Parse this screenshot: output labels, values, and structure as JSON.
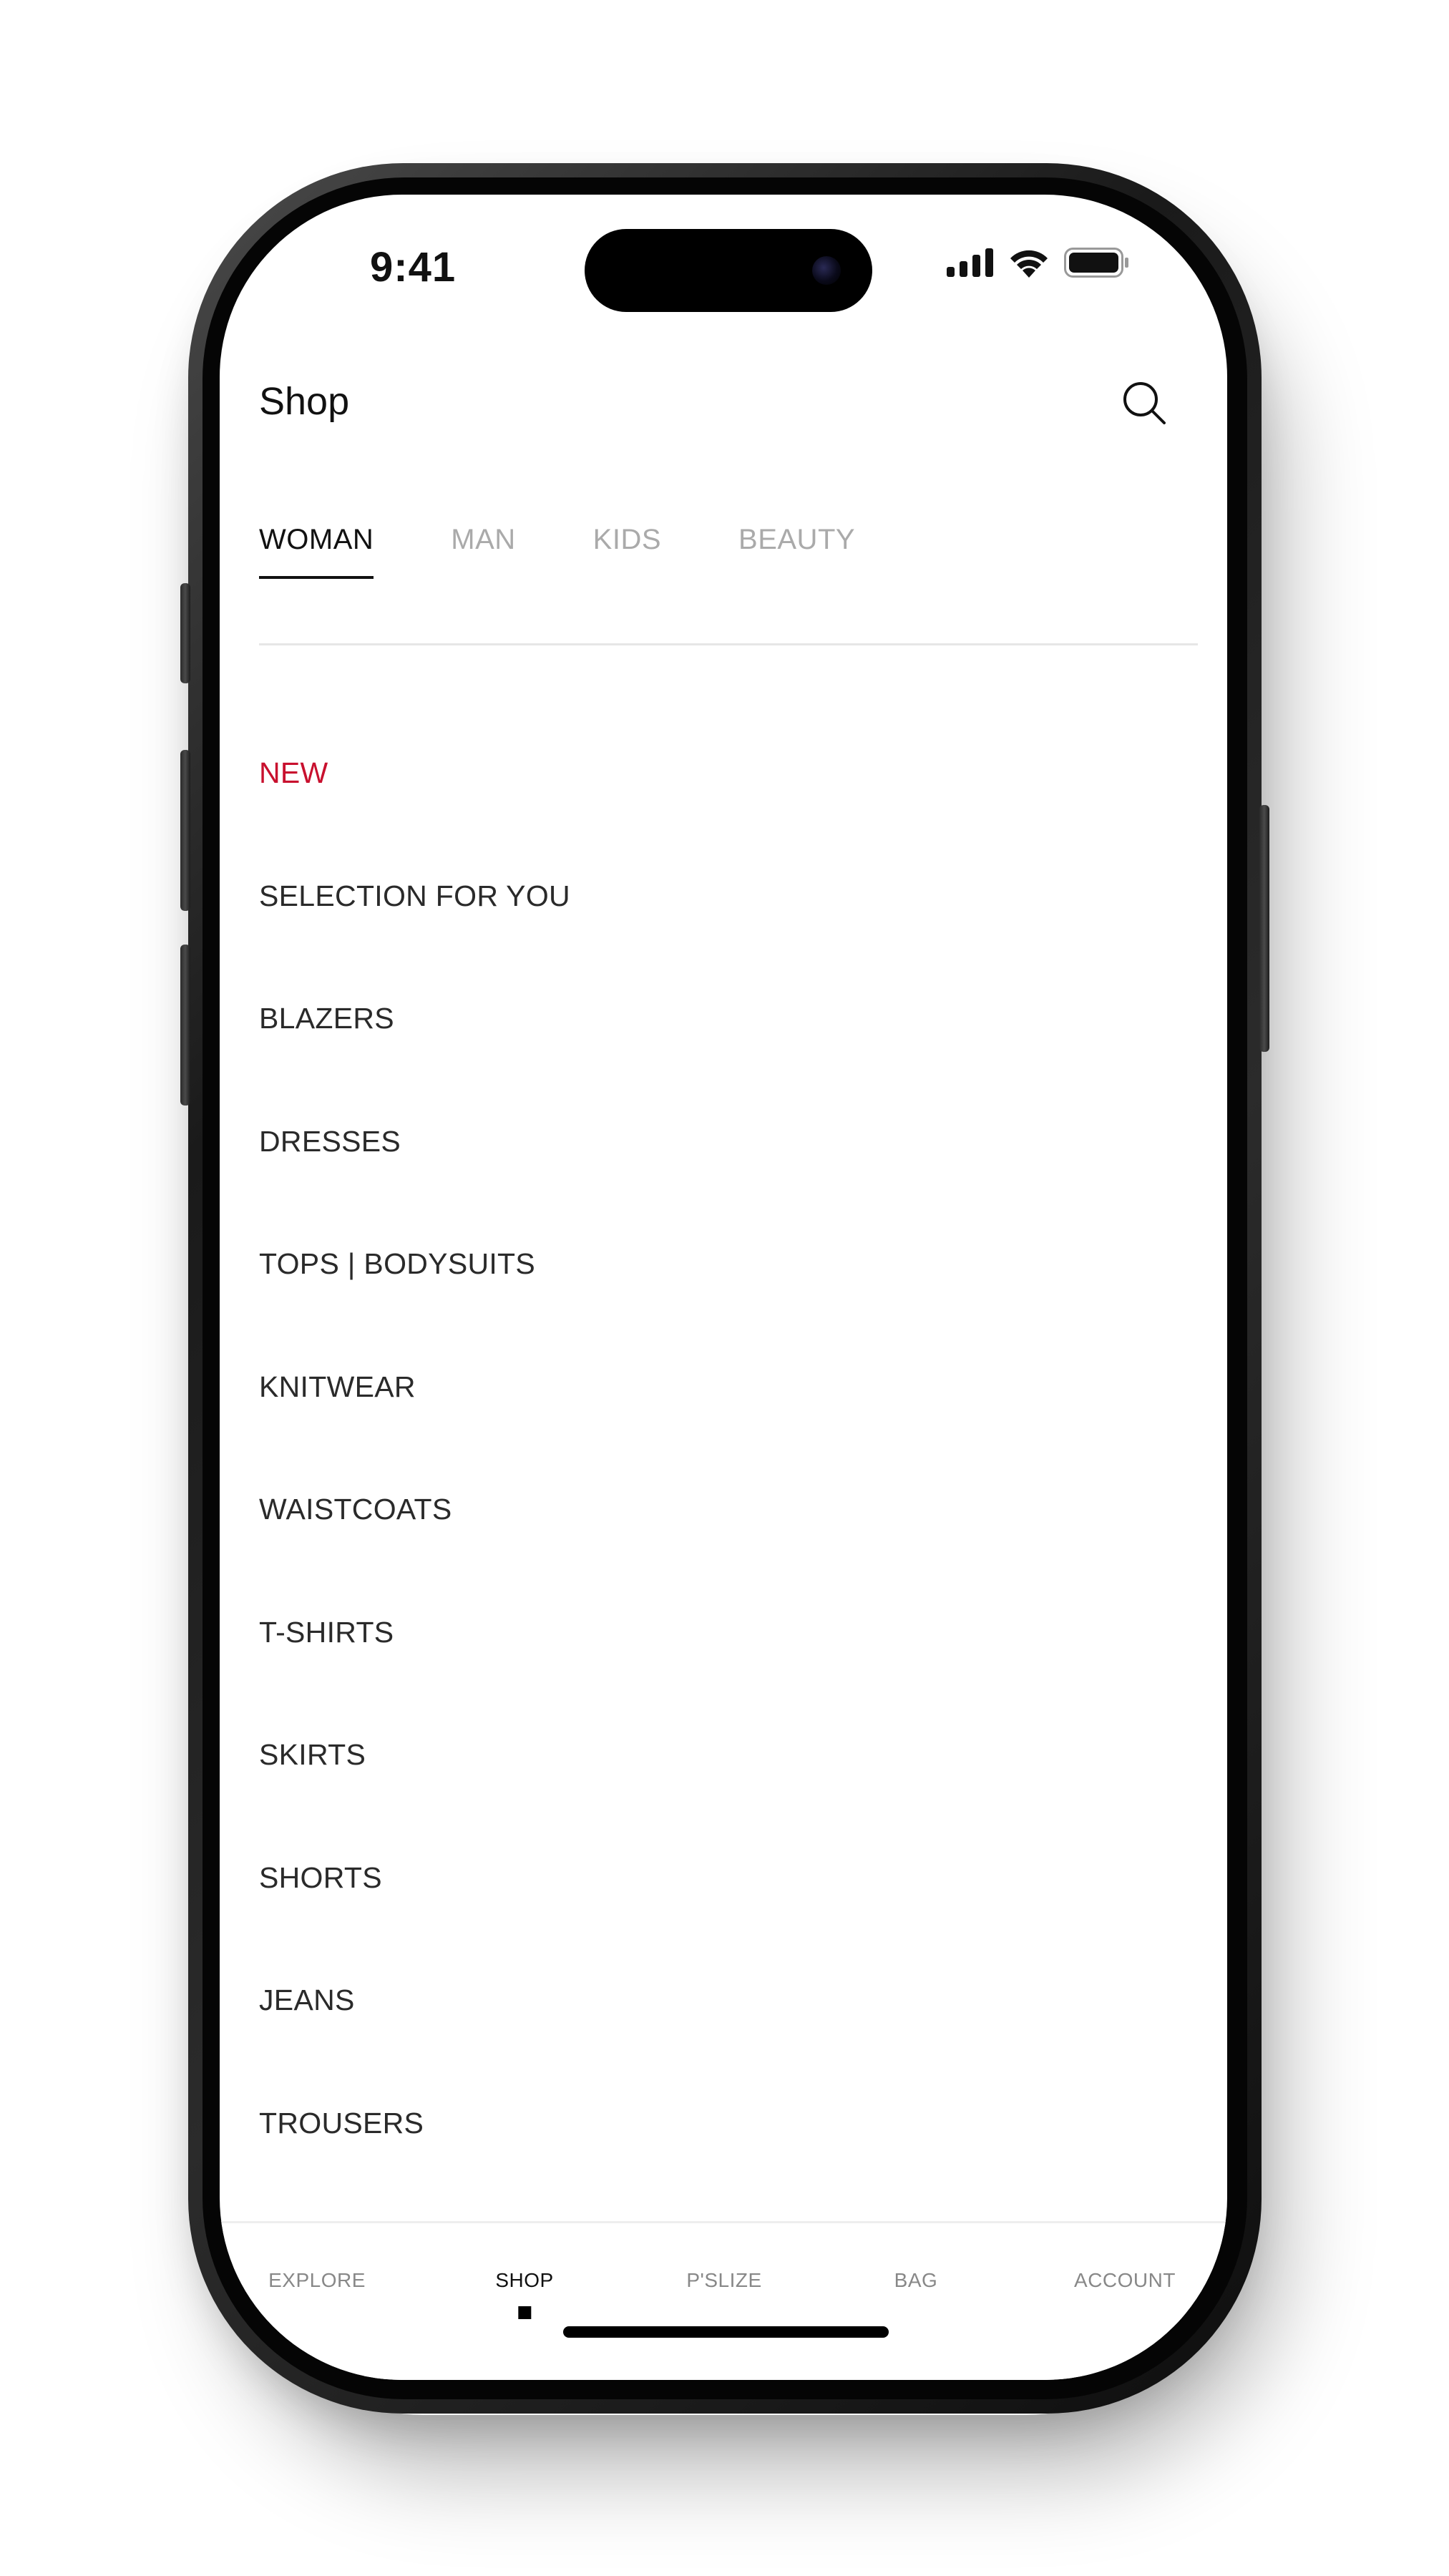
{
  "status_bar": {
    "time": "9:41"
  },
  "header": {
    "title": "Shop",
    "search_icon": "search-icon"
  },
  "tabs": [
    {
      "label": "WOMAN",
      "active": true
    },
    {
      "label": "MAN",
      "active": false
    },
    {
      "label": "KIDS",
      "active": false
    },
    {
      "label": "BEAUTY",
      "active": false
    }
  ],
  "categories": [
    {
      "label": "NEW",
      "highlight": true
    },
    {
      "label": "SELECTION FOR YOU"
    },
    {
      "label": "BLAZERS"
    },
    {
      "label": "DRESSES"
    },
    {
      "label": "TOPS | BODYSUITS"
    },
    {
      "label": "KNITWEAR"
    },
    {
      "label": "WAISTCOATS"
    },
    {
      "label": "T-SHIRTS"
    },
    {
      "label": "SKIRTS"
    },
    {
      "label": "SHORTS"
    },
    {
      "label": "JEANS"
    },
    {
      "label": "TROUSERS"
    }
  ],
  "bottom_nav": [
    {
      "label": "EXPLORE",
      "active": false
    },
    {
      "label": "SHOP",
      "active": true
    },
    {
      "label": "P'SLIZE",
      "active": false
    },
    {
      "label": "BAG",
      "active": false
    },
    {
      "label": "ACCOUNT",
      "active": false
    }
  ],
  "colors": {
    "accent_new": "#c8102e",
    "text_primary": "#111111",
    "text_inactive": "#aaaaaa"
  }
}
